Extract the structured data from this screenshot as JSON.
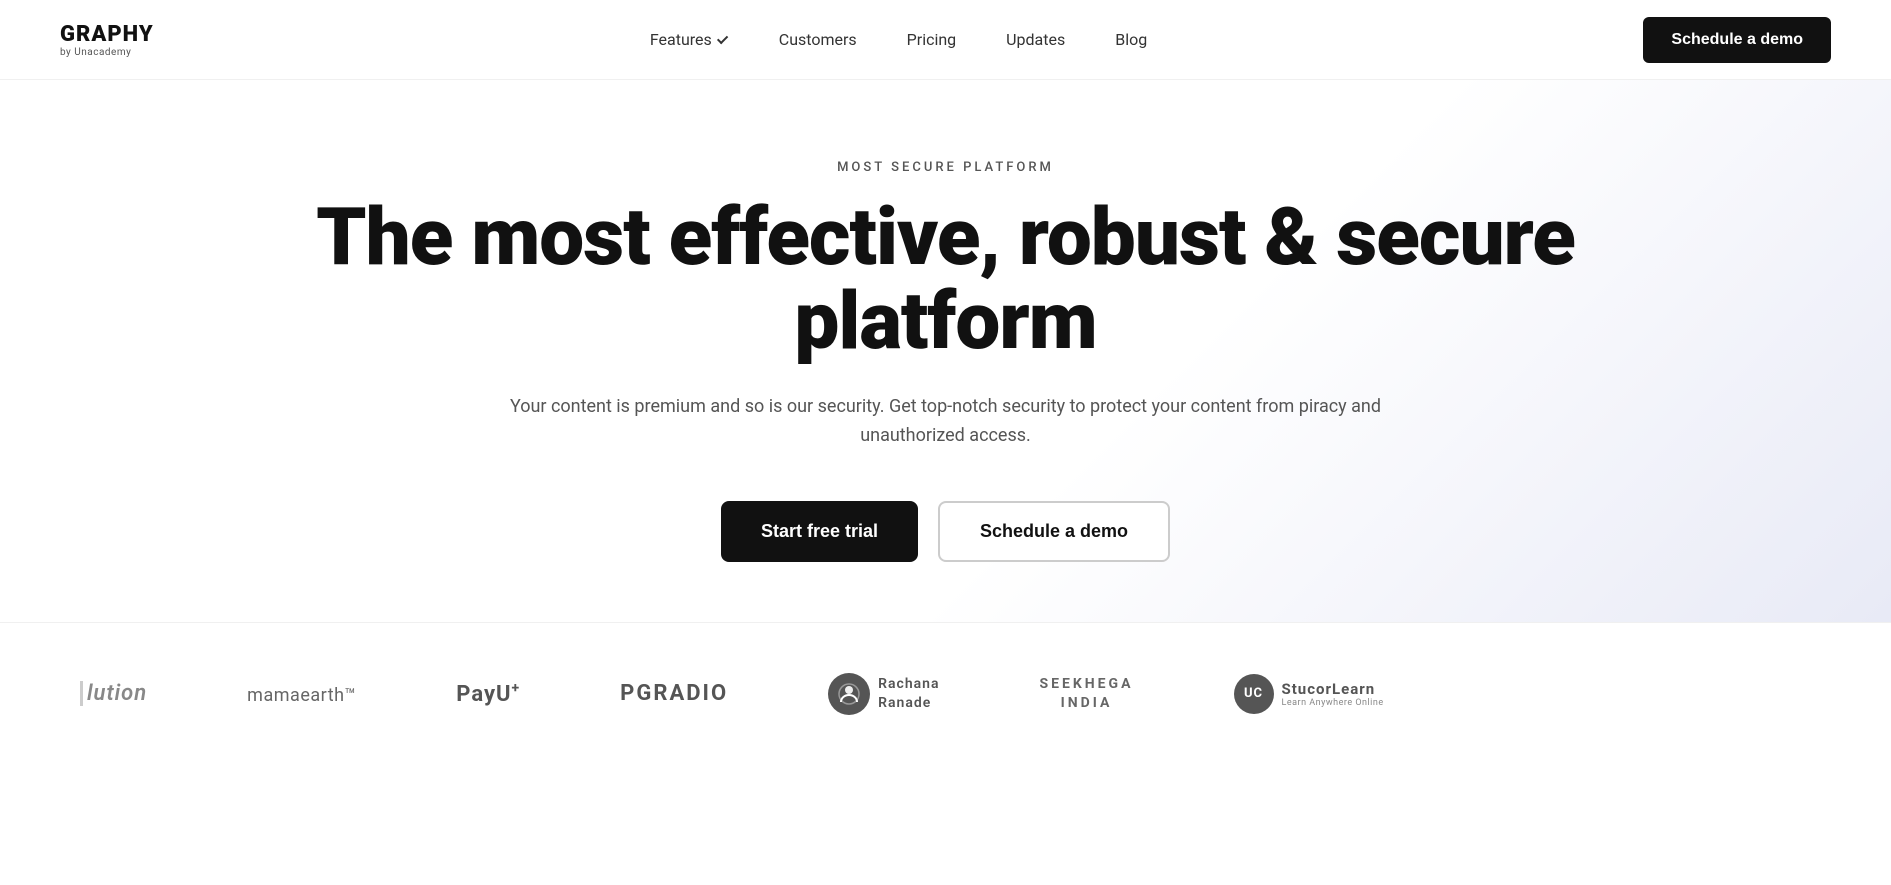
{
  "brand": {
    "name": "GRAPHY",
    "sub": "by Unacademy"
  },
  "nav": {
    "features_label": "Features",
    "customers_label": "Customers",
    "pricing_label": "Pricing",
    "updates_label": "Updates",
    "blog_label": "Blog",
    "cta_label": "Schedule a demo"
  },
  "hero": {
    "eyebrow": "MOST SECURE PLATFORM",
    "title": "The most effective, robust & secure platform",
    "subtitle": "Your content is premium and so is our security. Get top-notch security to protect your content from piracy and unauthorized access.",
    "btn_primary": "Start free trial",
    "btn_secondary": "Schedule a demo"
  },
  "logos": [
    {
      "id": "lution",
      "text": "lution",
      "type": "text-partial"
    },
    {
      "id": "mamaearth",
      "text": "mamaearth™",
      "type": "text"
    },
    {
      "id": "payu",
      "text": "PayU⁺",
      "type": "text"
    },
    {
      "id": "pgradio",
      "text": "PGRADIO",
      "type": "text"
    },
    {
      "id": "rachana",
      "line1": "Rachana",
      "line2": "Ranade",
      "type": "badge"
    },
    {
      "id": "seekhega",
      "line1": "SEEKHEGA",
      "line2": "INDIA",
      "type": "text-block"
    },
    {
      "id": "stucorlearn",
      "icon": "UC",
      "name": "StucorLearn",
      "sub": "Learn Anywhere Online",
      "type": "badge"
    }
  ]
}
